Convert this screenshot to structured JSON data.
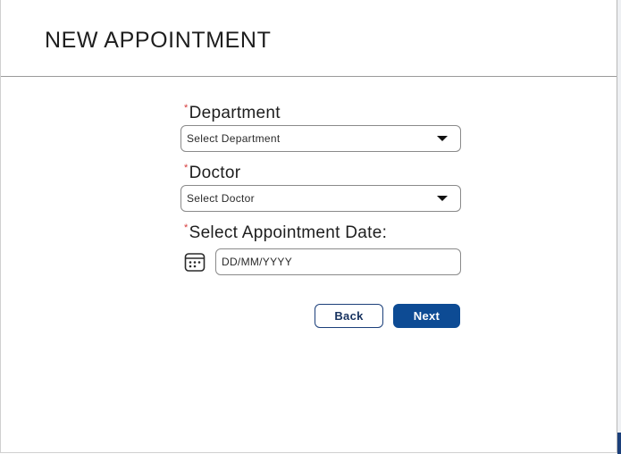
{
  "modal": {
    "title": "NEW APPOINTMENT"
  },
  "form": {
    "required_marker": "*",
    "department": {
      "label": "Department",
      "selected": "Select Department"
    },
    "doctor": {
      "label": "Doctor",
      "selected": "Select Doctor"
    },
    "date": {
      "label": "Select Appointment Date:",
      "placeholder": "DD/MM/YYYY",
      "value": ""
    }
  },
  "actions": {
    "back_label": "Back",
    "next_label": "Next"
  },
  "colors": {
    "required": "#d63a3a",
    "primary": "#0d4b94",
    "outline_button_border": "#1b3f7a",
    "text": "#1e1e1e"
  },
  "icons": {
    "dropdown": "caret-down-icon",
    "date_picker": "calendar-icon"
  }
}
